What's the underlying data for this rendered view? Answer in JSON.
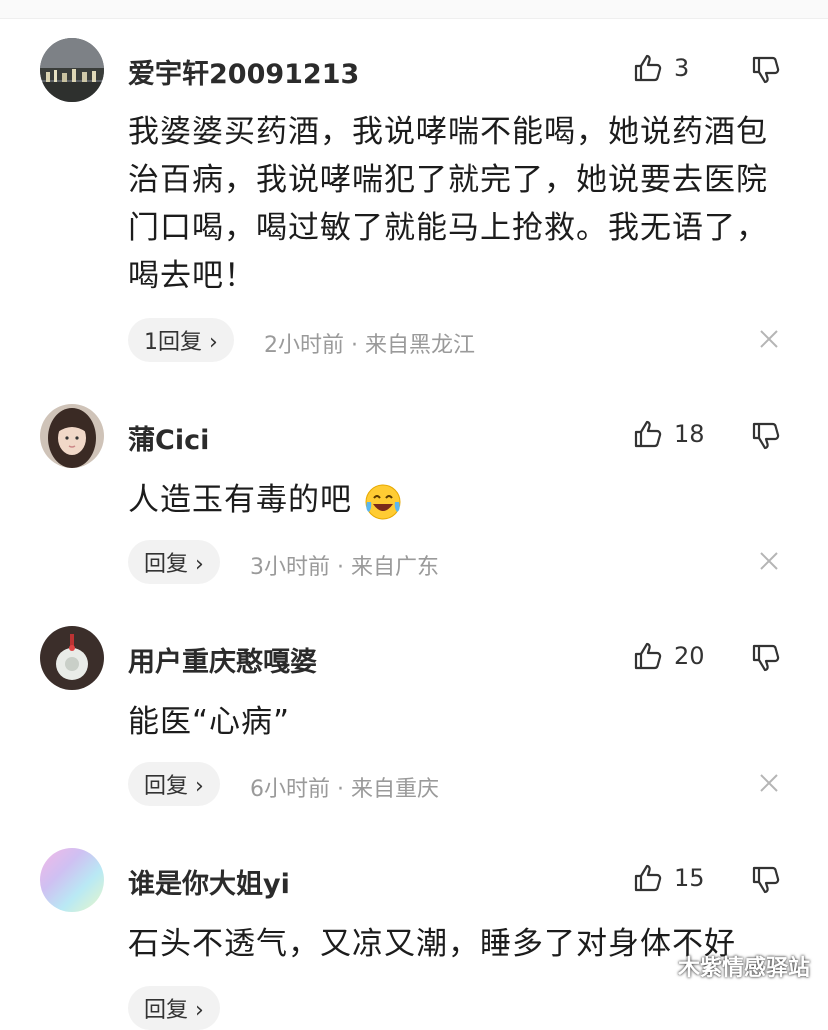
{
  "comments": [
    {
      "username": "爱宇轩20091213",
      "likes": "3",
      "text_lines": [
        "我婆婆买药酒，我说哮喘不能喝，她说药酒包",
        "治百病，我说哮喘犯了就完了，她说要去医院",
        "门口喝，喝过敏了就能马上抢救。我无语了，",
        "喝去吧！"
      ],
      "reply_label": "1回复 ›",
      "meta": "2小时前 · 来自黑龙江",
      "avatar_icon": "city-night-photo-avatar"
    },
    {
      "username": "蒲Cici",
      "likes": "18",
      "text": "人造玉有毒的吧",
      "emoji_icon": "crying-laughing-face-emoji",
      "reply_label": "回复 ›",
      "meta": "3小时前 · 来自广东",
      "avatar_icon": "girl-portrait-avatar"
    },
    {
      "username": "用户重庆憨嘎婆",
      "likes": "20",
      "text": "能医“心病”",
      "reply_label": "回复 ›",
      "meta": "6小时前 · 来自重庆",
      "avatar_icon": "jade-pendant-avatar"
    },
    {
      "username": "谁是你大姐yi",
      "likes": "15",
      "text": "石头不透气，又凉又潮，睡多了对身体不好",
      "reply_label": "回复 ›",
      "avatar_icon": "rainbow-gradient-avatar"
    }
  ],
  "watermark": "木紫情感驿站",
  "colors": {
    "meta_gray": "#9a9a9a",
    "reply_bg": "#f2f2f2",
    "text": "#1c1c1c"
  }
}
